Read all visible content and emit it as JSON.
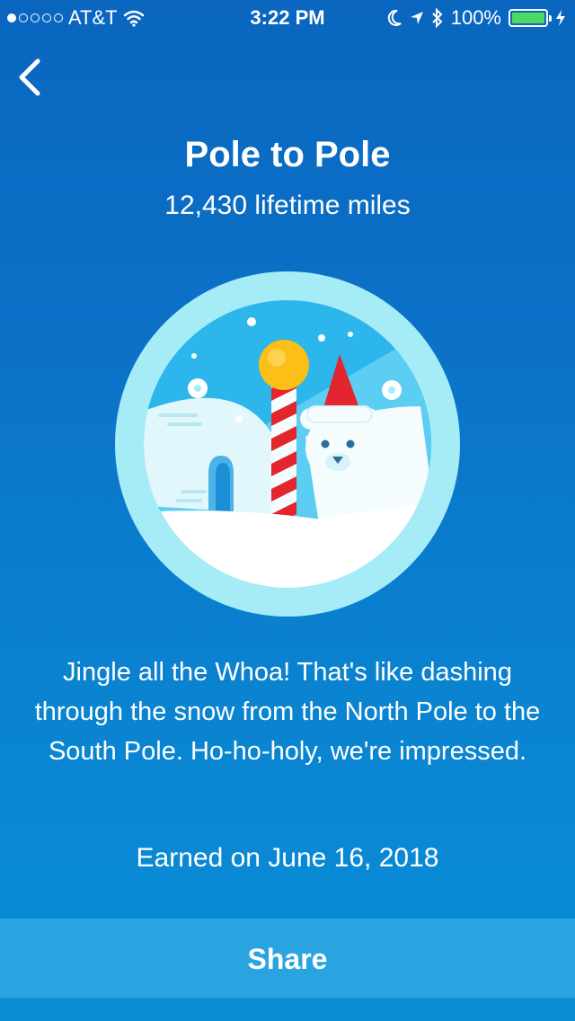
{
  "status_bar": {
    "carrier": "AT&T",
    "time": "3:22 PM",
    "battery_percent": "100%",
    "battery_color": "#4cd964"
  },
  "header": {
    "back_icon": "chevron-left-icon"
  },
  "badge": {
    "title": "Pole to Pole",
    "subtitle": "12,430 lifetime miles",
    "image_icon": "north-pole-badge-icon"
  },
  "description": "Jingle all the Whoa! That's like dashing through the snow from the North Pole to the South Pole. Ho-ho-holy, we're impressed.",
  "earned": "Earned on June 16, 2018",
  "share": {
    "label": "Share",
    "color": "#2aa4e0"
  }
}
